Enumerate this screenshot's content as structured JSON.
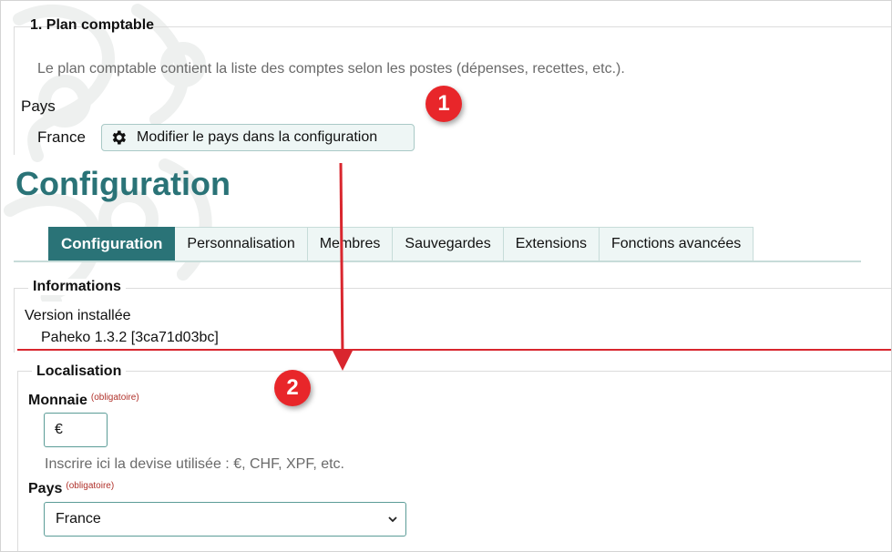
{
  "plan": {
    "legend": "1. Plan comptable",
    "description": "Le plan comptable contient la liste des comptes selon les postes (dépenses, recettes, etc.).",
    "pays_label": "Pays",
    "pays_value": "France",
    "modify_button": "Modifier le pays dans la configuration",
    "button_icon": "gear-icon"
  },
  "config": {
    "title": "Configuration",
    "tabs": [
      "Configuration",
      "Personnalisation",
      "Membres",
      "Sauvegardes",
      "Extensions",
      "Fonctions avancées"
    ],
    "active_tab": "Configuration"
  },
  "informations": {
    "legend": "Informations",
    "version_label": "Version installée",
    "version_value": "Paheko 1.3.2 [3ca71d03bc]"
  },
  "localisation": {
    "legend": "Localisation",
    "monnaie_label": "Monnaie",
    "required_tag": "(obligatoire)",
    "monnaie_value": "€",
    "monnaie_help": "Inscrire ici la devise utilisée : €, CHF, XPF, etc.",
    "pays_label": "Pays",
    "pays_value": "France"
  },
  "annotations": {
    "badge1": "1",
    "badge2": "2"
  },
  "colors": {
    "accent": "#2a7377",
    "annotation_red": "#e8262a",
    "divider_red": "#d9262e"
  }
}
